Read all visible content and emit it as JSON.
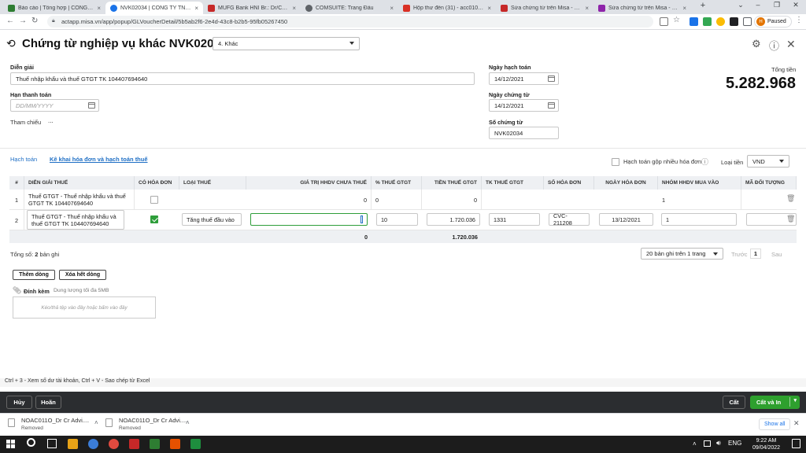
{
  "browser": {
    "tabs": [
      {
        "title": "Báo cáo | Tổng hợp | CÔNG TY",
        "color": "#2e7d32"
      },
      {
        "title": "NVK02034 | CÔNG TY TNHH CH",
        "color": "#1a73e8",
        "active": true
      },
      {
        "title": "MUFG Bank HNI Br.: Dr/Cr Advi",
        "color": "#c62828"
      },
      {
        "title": "COMSUITE: Trang Đầu",
        "color": "#5f6368"
      },
      {
        "title": "Hộp thư đến (31) - acc01019143",
        "color": "#d93025"
      },
      {
        "title": "Sửa chứng từ trên Misa - Trả lời",
        "color": "#c62828"
      },
      {
        "title": "Sửa chứng từ trên Misa - Forum",
        "color": "#8e24aa"
      }
    ],
    "url": "actapp.misa.vn/app/popup/GLVoucherDetail/5b5ab2f6-2e4d-43c8-b2b5-95fb05267450",
    "profile_initial": "H",
    "profile_status": "Paused"
  },
  "header": {
    "title": "Chứng từ nghiệp vụ khác NVK02034",
    "type_select": "4. Khác"
  },
  "form": {
    "description_label": "Diễn giải",
    "description_value": "Thuế nhập khẩu và thuế GTGT TK 104407694640",
    "due_label": "Hạn thanh toán",
    "due_placeholder": "DD/MM/YYYY",
    "reference_label": "Tham chiếu",
    "reference_value": "...",
    "posting_date_label": "Ngày hạch toán",
    "posting_date": "14/12/2021",
    "voucher_date_label": "Ngày chứng từ",
    "voucher_date": "14/12/2021",
    "voucher_no_label": "Số chứng từ",
    "voucher_no": "NVK02034",
    "total_label": "Tổng tiền",
    "total_value": "5.282.968"
  },
  "tabs": {
    "accounting": "Hạch toán",
    "invoice": "Kê khai hóa đơn và hạch toán thuế"
  },
  "options": {
    "multi_invoice_label": "Hạch toán gộp nhiều hóa đơn",
    "currency_label": "Loại tiền",
    "currency_value": "VND"
  },
  "grid": {
    "headers": [
      "#",
      "DIỄN GIẢI THUẾ",
      "CÓ HÓA ĐƠN",
      "LOẠI THUẾ",
      "GIÁ TRỊ HHDV CHƯA THUẾ",
      "% THUẾ GTGT",
      "TIỀN THUẾ GTGT",
      "TK THUẾ GTGT",
      "SỐ HÓA ĐƠN",
      "NGÀY HÓA ĐƠN",
      "NHÓM HHDV MUA VÀO",
      "MÃ ĐỐI TƯỢNG"
    ],
    "rows": [
      {
        "no": "1",
        "desc": "Thuế GTGT - Thuế nhập khẩu và thuế GTGT TK 104407694640",
        "has_invoice": false,
        "tax_type": "",
        "value": "0",
        "pct": "0",
        "tax": "0",
        "account": "",
        "invoice_no": "",
        "invoice_date": "",
        "group": "1",
        "partner": ""
      },
      {
        "no": "2",
        "desc": "Thuế GTGT - Thuế nhập khẩu và thuế GTGT TK 104407694640",
        "has_invoice": true,
        "tax_type": "Tăng thuế đầu vào",
        "value": "",
        "pct": "10",
        "tax": "1.720.036",
        "account": "1331",
        "invoice_no": "CVC-211208",
        "invoice_date": "13/12/2021",
        "group": "1",
        "partner": ""
      }
    ],
    "totals": {
      "value": "0",
      "tax": "1.720.036"
    }
  },
  "footer": {
    "total_records_label": "Tổng số:",
    "total_records_count": "2",
    "total_records_unit": "bản ghi",
    "page_size": "20 bản ghi trên 1 trang",
    "prev": "Trước",
    "page": "1",
    "next": "Sau",
    "add_row": "Thêm dòng",
    "delete_all": "Xóa hết dòng",
    "attach_label": "Đính kèm",
    "attach_limit": "Dung lượng tối đa 5MB",
    "dropzone": "Kéo/thả tệp vào đây hoặc bấm vào đây"
  },
  "hint": "Ctrl + 3 - Xem số dư tài khoản, Ctrl + V - Sao chép từ Excel",
  "actions": {
    "cancel": "Hủy",
    "undo": "Hoãn",
    "save": "Cất",
    "save_print": "Cất và In"
  },
  "downloads": [
    {
      "name": "NOAC011O_Dr Cr Advi....",
      "status": "Removed"
    },
    {
      "name": "NOAC011O_Dr Cr Advi....",
      "status": "Removed"
    }
  ],
  "downloads_show_all": "Show all",
  "taskbar": {
    "time": "9:22 AM",
    "date": "09/04/2022",
    "lang": "ENG",
    "app_colors": [
      "#e8a317",
      "#3b7dd8",
      "#e04a3f",
      "#c62828",
      "#2e7d32",
      "#d32f2f",
      "#e65100",
      "#1e8e3e"
    ]
  }
}
